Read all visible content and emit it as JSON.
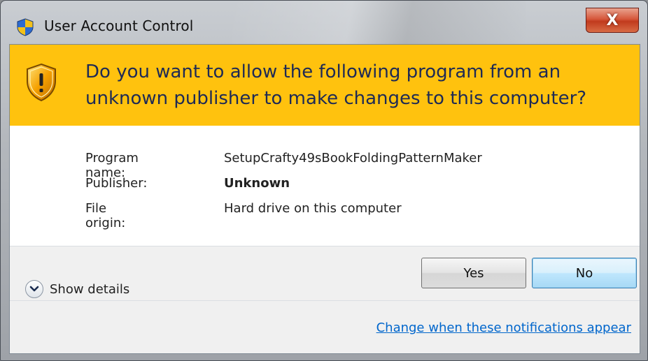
{
  "window": {
    "title": "User Account Control",
    "close_label": "X"
  },
  "banner": {
    "question": "Do you want to allow the following program from an unknown publisher to make changes to this computer?",
    "color": "#ffc20e"
  },
  "details": [
    {
      "label": "Program name:",
      "value": "SetupCrafty49sBookFoldingPatternMaker"
    },
    {
      "label": "Publisher:",
      "value": "Unknown"
    },
    {
      "label": "File origin:",
      "value": "Hard drive on this computer"
    }
  ],
  "footer": {
    "show_details_label": "Show details",
    "yes_label": "Yes",
    "no_label": "No",
    "notification_link": "Change when these notifications appear"
  },
  "icons": {
    "title_icon": "uac-shield-icon",
    "banner_icon": "warning-shield-icon",
    "expand_icon": "chevron-down-icon"
  }
}
